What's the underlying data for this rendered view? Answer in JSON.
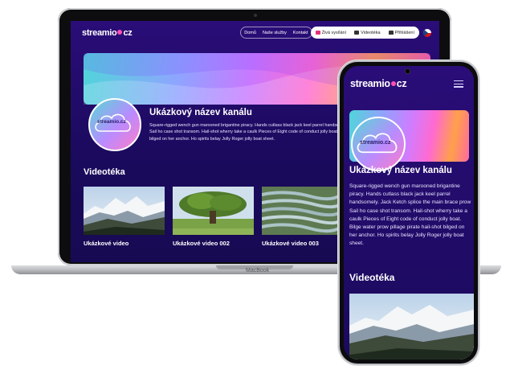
{
  "site": {
    "logo_text_left": "streamio",
    "logo_text_right": "cz"
  },
  "nav": {
    "links": [
      "Domů",
      "Naše služby",
      "Kontakt"
    ],
    "live_label": "Živá vysílání",
    "videoteka_label": "Videotéka",
    "login_label": "Přihlášení",
    "language_flag": "czech-flag"
  },
  "channel": {
    "title": "Ukázkový název kanálu",
    "avatar_logo": "streamio.cz",
    "description_laptop": "Square-rigged wench gun marooned brigantine piracy. Hands cutlass black jack keel parrel handsomely. Jack Ketch splice the main brace prow Sail ho case shot transom. Hail-shot wherry take a caulk Pieces of Eight code of conduct jolly boat. Bilge water prow pillage pirate hail-shot bilged on her anchor. Ho spirits belay Jolly Roger jolly boat sheet.",
    "description_phone": "Square-rigged wench gun marooned brigantine piracy. Hands cutlass black jack keel parrel handsomely. Jack Ketch splice the main brace prow Sail ho case shot transom. Hail-shot wherry take a caulk Pieces of Eight code of conduct jolly boat. Bilge water prow pillage pirate hail-shot bilged on her anchor. Ho spirits belay Jolly Roger jolly boat sheet."
  },
  "library": {
    "title": "Videotéka",
    "videos": [
      {
        "title": "Ukázkové video",
        "thumb": "mountains"
      },
      {
        "title": "Ukázkové video 002",
        "thumb": "tree"
      },
      {
        "title": "Ukázkové video 003",
        "thumb": "rice-terraces"
      }
    ]
  },
  "device": {
    "laptop_label": "MacBook"
  },
  "colors": {
    "background": "#1a0a5c",
    "accent_pink": "#ff4fb5",
    "live_icon": "#e4317b"
  }
}
